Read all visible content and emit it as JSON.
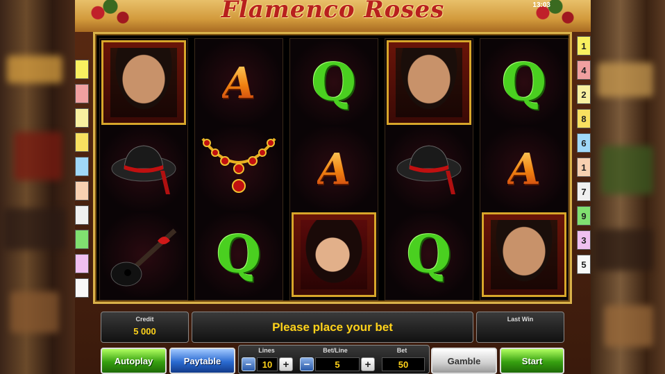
{
  "game": {
    "title": "Flamenco Roses",
    "clock": "13:03"
  },
  "reels": [
    [
      "man",
      "hat",
      "guitar"
    ],
    [
      "ace",
      "necklace",
      "queen"
    ],
    [
      "queen",
      "ace",
      "woman"
    ],
    [
      "man",
      "hat",
      "queen"
    ],
    [
      "queen",
      "ace",
      "man"
    ]
  ],
  "symbol_text": {
    "ace": "A",
    "queen": "Q"
  },
  "paylines": {
    "left": [
      "",
      "",
      "",
      "",
      "",
      "",
      "",
      "",
      "",
      ""
    ],
    "right": [
      "1",
      "4",
      "2",
      "8",
      "6",
      "1",
      "7",
      "9",
      "3",
      "5"
    ]
  },
  "colors": {
    "credit_value": "#ffd21a",
    "message": "#ffd21a",
    "frame_gold": "#d9b24a"
  },
  "panel": {
    "credit_label": "Credit",
    "credit_value": "5 000",
    "message": "Please place your bet",
    "last_win_label": "Last Win",
    "last_win_value": "",
    "lines_label": "Lines",
    "lines_value": "10",
    "betline_label": "Bet/Line",
    "betline_value": "5",
    "bet_label": "Bet",
    "bet_value": "50"
  },
  "buttons": {
    "autoplay": "Autoplay",
    "paytable": "Paytable",
    "gamble": "Gamble",
    "start": "Start",
    "minus": "−",
    "plus": "+"
  }
}
